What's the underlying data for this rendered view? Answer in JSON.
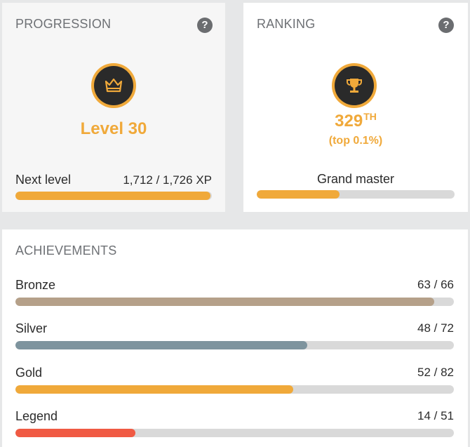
{
  "progression": {
    "title": "PROGRESSION",
    "help_icon": "question-mark-icon",
    "medal_icon": "crown-icon",
    "level": "Level 30",
    "next_label": "Next level",
    "xp_text": "1,712 / 1,726 XP",
    "progress": 0.992
  },
  "ranking": {
    "title": "RANKING",
    "help_icon": "question-mark-icon",
    "medal_icon": "trophy-icon",
    "rank_number": "329",
    "rank_suffix": "TH",
    "top_text": "(top 0.1%)",
    "tier": "Grand master",
    "progress": 0.42
  },
  "achievements": {
    "title": "ACHIEVEMENTS",
    "items": [
      {
        "label": "Bronze",
        "value": "63 / 66",
        "progress": 0.955,
        "color": "#b5a089"
      },
      {
        "label": "Silver",
        "value": "48 / 72",
        "progress": 0.666,
        "color": "#7e949e"
      },
      {
        "label": "Gold",
        "value": "52 / 82",
        "progress": 0.634,
        "color": "#f0a93a"
      },
      {
        "label": "Legend",
        "value": "14 / 51",
        "progress": 0.274,
        "color": "#f05a43"
      }
    ]
  },
  "colors": {
    "accent": "#f0a93a",
    "track": "#d9d9d9"
  }
}
